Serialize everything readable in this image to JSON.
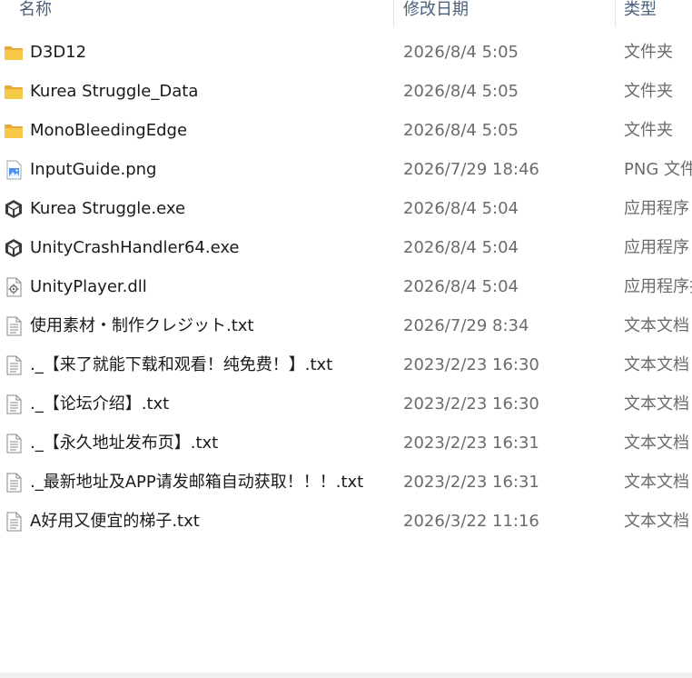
{
  "columns": {
    "name": "名称",
    "date": "修改日期",
    "type": "类型"
  },
  "files": [
    {
      "name": "D3D12",
      "date": "2026/8/4 5:05",
      "type": "文件夹",
      "icon": "folder-icon"
    },
    {
      "name": "Kurea Struggle_Data",
      "date": "2026/8/4 5:05",
      "type": "文件夹",
      "icon": "folder-icon"
    },
    {
      "name": "MonoBleedingEdge",
      "date": "2026/8/4 5:05",
      "type": "文件夹",
      "icon": "folder-icon"
    },
    {
      "name": "InputGuide.png",
      "date": "2026/7/29 18:46",
      "type": "PNG 文件",
      "icon": "image-file-icon"
    },
    {
      "name": "Kurea Struggle.exe",
      "date": "2026/8/4 5:04",
      "type": "应用程序",
      "icon": "unity-app-icon"
    },
    {
      "name": "UnityCrashHandler64.exe",
      "date": "2026/8/4 5:04",
      "type": "应用程序",
      "icon": "unity-app-icon"
    },
    {
      "name": "UnityPlayer.dll",
      "date": "2026/8/4 5:04",
      "type": "应用程序扩展",
      "icon": "dll-file-icon"
    },
    {
      "name": "使用素材・制作クレジット.txt",
      "date": "2026/7/29 8:34",
      "type": "文本文档",
      "icon": "text-file-icon"
    },
    {
      "name": "._【来了就能下载和观看！纯免费！】.txt",
      "date": "2023/2/23 16:30",
      "type": "文本文档",
      "icon": "text-file-icon"
    },
    {
      "name": "._【论坛介绍】.txt",
      "date": "2023/2/23 16:30",
      "type": "文本文档",
      "icon": "text-file-icon"
    },
    {
      "name": "._【永久地址发布页】.txt",
      "date": "2023/2/23 16:31",
      "type": "文本文档",
      "icon": "text-file-icon"
    },
    {
      "name": "._最新地址及APP请发邮箱自动获取！！！.txt",
      "date": "2023/2/23 16:31",
      "type": "文本文档",
      "icon": "text-file-icon"
    },
    {
      "name": "A好用又便宜的梯子.txt",
      "date": "2026/3/22 11:16",
      "type": "文本文档",
      "icon": "text-file-icon"
    }
  ],
  "colors": {
    "folder": "#f5c342",
    "header_text": "#4c607a",
    "secondary_text": "#6b6b6b"
  }
}
